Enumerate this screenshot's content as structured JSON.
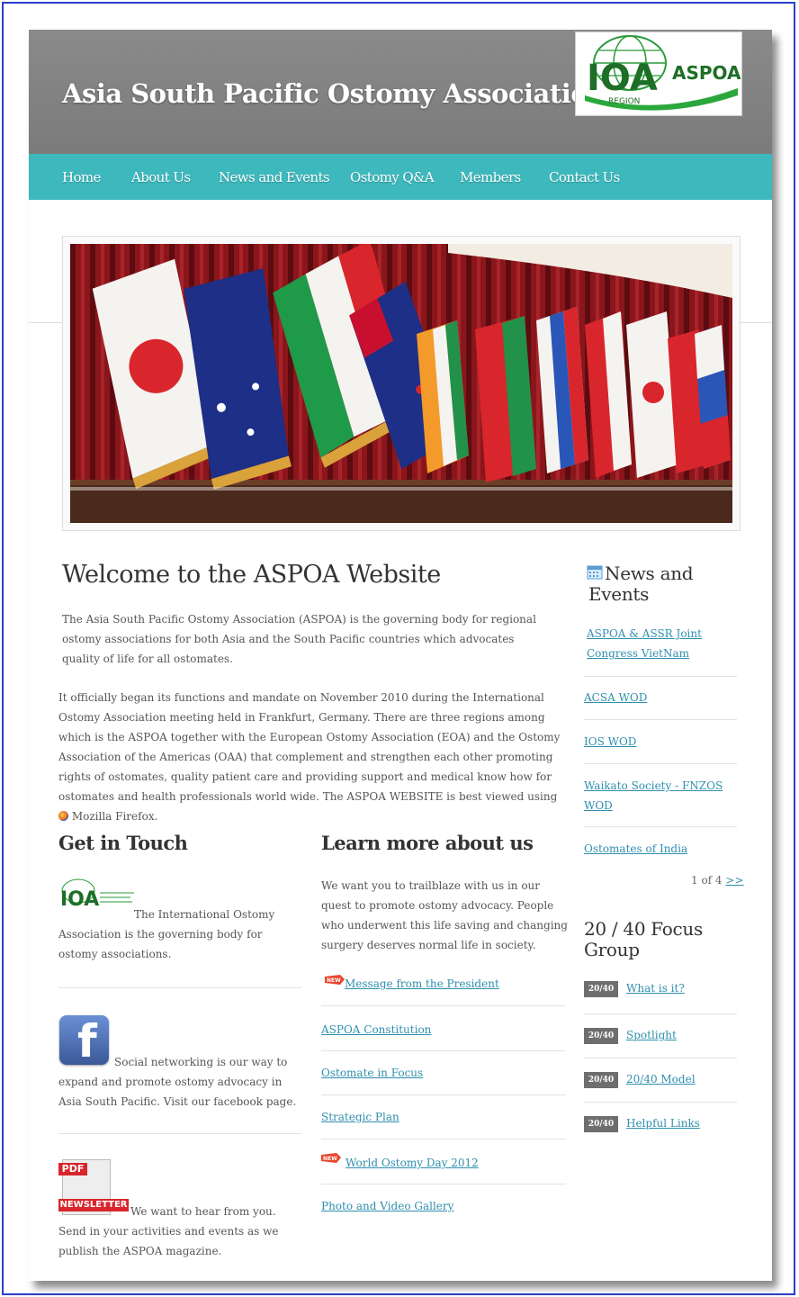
{
  "site": {
    "title": "Asia South Pacific Ostomy Association",
    "logo_text": "IOA",
    "logo_subtext": "ASPOA",
    "logo_region": "REGION"
  },
  "nav": {
    "items": [
      "Home",
      "About Us",
      "News and Events",
      "Ostomy Q&A",
      "Members",
      "Contact Us"
    ]
  },
  "welcome": {
    "title": "Welcome to the ASPOA Website",
    "para1": "The Asia South Pacific Ostomy Association (ASPOA) is the governing body for regional ostomy associations for both Asia and the South Pacific countries which advocates quality of life for all ostomates.",
    "para2_start": "It officially began its functions and mandate on November 2010 during the International Ostomy Association meeting held in Frankfurt, Germany. There are three regions among which is the ASPOA together with the European Ostomy Association (EOA) and the Ostomy Association of the Americas (OAA) that complement and strengthen each other promoting rights of ostomates, quality patient care and providing support and medical know how for ostomates and health professionals world wide. The ASPOA WEBSITE is best viewed using",
    "para2_end": "Mozilla Firefox."
  },
  "get_in_touch": {
    "title": "Get in Touch",
    "ioa_text": "The International Ostomy Association is the governing body for ostomy associations.",
    "ioa_logo_text": "IOA",
    "facebook_text": "Social networking is our way to expand and promote ostomy advocacy in Asia South Pacific. Visit our facebook page.",
    "newsletter_text": "We want to hear from you. Send in your activities and events as we publish the ASPOA magazine.",
    "pdf_label": "PDF",
    "newsletter_label": "NEWSLETTER"
  },
  "learn_more": {
    "title": "Learn more about us",
    "text": "We want you to trailblaze with us in our quest to promote ostomy advocacy. People who underwent this life saving and changing surgery deserves normal life in society.",
    "links": [
      "Message from the President",
      "ASPOA Constitution",
      "Ostomate in Focus",
      "Strategic Plan",
      "World Ostomy Day 2012",
      "Photo and Video Gallery"
    ],
    "new_label": "NEW"
  },
  "news": {
    "title": "News and Events",
    "items": [
      "ASPOA & ASSR Joint Congress VietNam",
      "ACSA WOD",
      "IOS WOD",
      "Waikato Society - FNZOS WOD",
      "Ostomates of India"
    ],
    "pager": "1 of 4",
    "pager_next": ">>"
  },
  "focus": {
    "title": "20 / 40 Focus Group",
    "badge": "20/40",
    "items": [
      "What is it?",
      "Spotlight",
      "20/40 Model",
      "Helpful Links"
    ]
  },
  "colors": {
    "nav": "#3db8bd",
    "header": "#7e7e7e",
    "link": "#2f8fae",
    "frame": "#2b3fc9"
  }
}
